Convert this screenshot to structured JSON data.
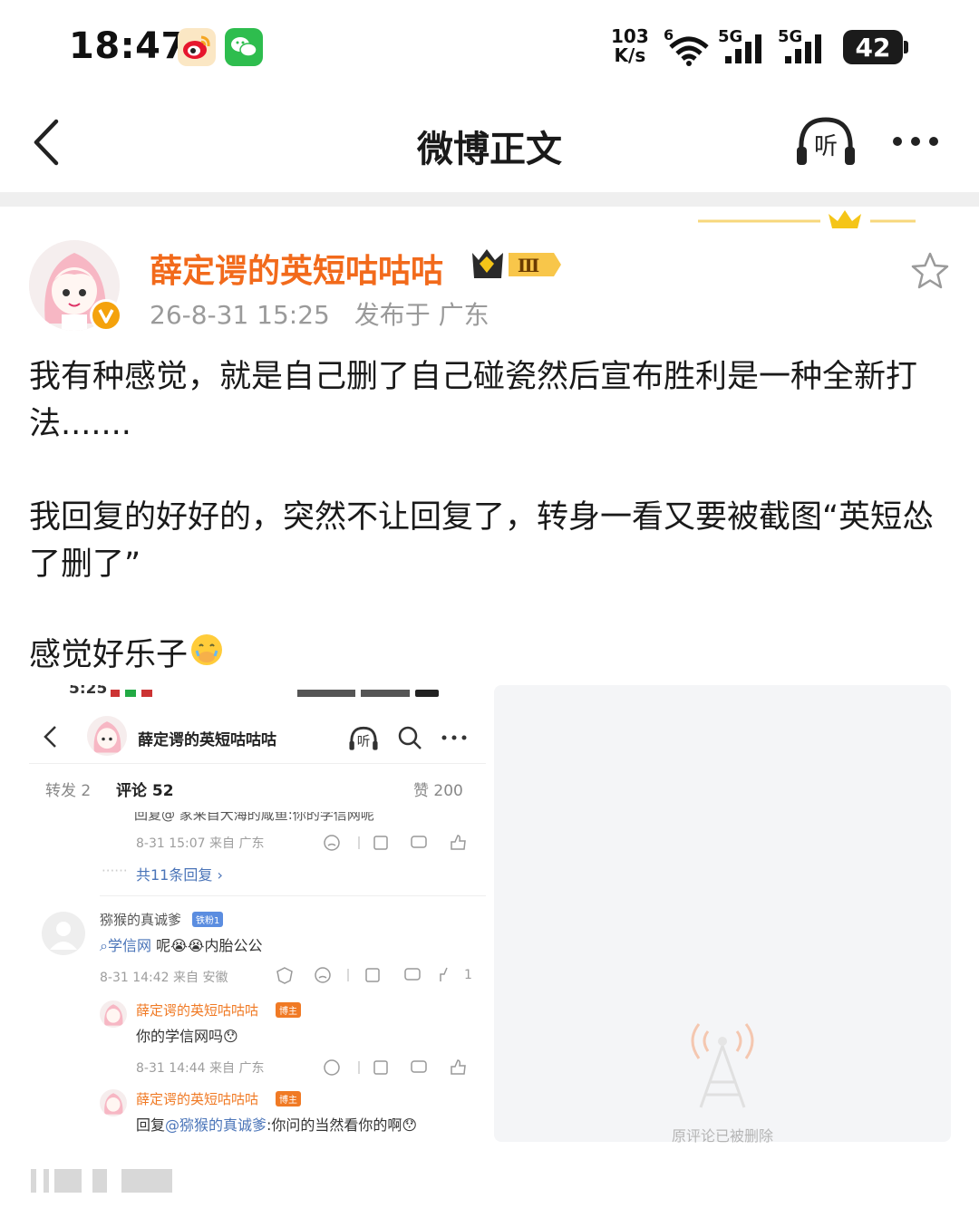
{
  "status_bar": {
    "time": "18:47",
    "net_speed_value": "103",
    "net_speed_unit": "K/s",
    "wifi_label": "6",
    "sim1_label": "5G",
    "sim2_label": "5G",
    "battery": "42"
  },
  "nav": {
    "title": "微博正文",
    "listen_label": "听"
  },
  "post": {
    "author_name": "薛定谔的英短咕咕咕",
    "level_label": "Ⅲ",
    "timestamp": "26-8-31 15:25",
    "location": "发布于 广东",
    "paragraphs": [
      "我有种感觉，就是自己删了自己碰瓷然后宣布胜利是一种全新打法.......",
      "我回复的好好的，突然不让回复了，转身一看又要被截图“英短怂了删了”",
      "感觉好乐子"
    ]
  },
  "screenshot": {
    "status_time": "5:25",
    "header_name": "薛定谔的英短咕咕咕",
    "listen_label": "听",
    "tabs": {
      "repost": "转发 2",
      "comment": "评论 52",
      "like": "赞 200"
    },
    "cut_line": "回复@ 家来自大海的咸鱼:你的学信网呢",
    "reply_meta": "8-31 15:07 来自 广东",
    "reply_count": "共11条回复",
    "comment": {
      "user": "猕猴的真诚爹",
      "badge": "铁粉1",
      "text_link": "学信网",
      "text_rest": " 呢😭😭内胎公公",
      "meta": "8-31 14:42 来自 安徽",
      "likes": "1"
    },
    "replies": [
      {
        "user": "薛定谔的英短咕咕咕",
        "badge": "博主",
        "text": "你的学信网吗😯",
        "meta": "8-31 14:44 来自 广东"
      },
      {
        "user": "薛定谔的英短咕咕咕",
        "badge": "博主",
        "text_prefix": "回复",
        "mention": "@猕猴的真诚爹",
        "text": ":你问的当然看你的啊😯"
      }
    ]
  },
  "deleted_image": {
    "caption": "原评论已被删除"
  },
  "colors": {
    "accent_orange": "#f26a1b",
    "link_blue": "#4a74b8",
    "vip_gold": "#f4a20c"
  }
}
